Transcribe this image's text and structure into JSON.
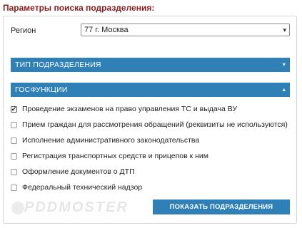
{
  "header": {
    "title": "Параметры поиска подразделения:"
  },
  "region": {
    "label": "Регион",
    "selected": "77 г. Москва",
    "arrow_icon": "▾"
  },
  "sections": {
    "type": {
      "label": "ТИП ПОДРАЗДЕЛЕНИЯ",
      "state": "collapsed",
      "chevron": "▾"
    },
    "gos": {
      "label": "ГОСФУНКЦИИ",
      "state": "expanded",
      "chevron": "▴"
    }
  },
  "services": [
    {
      "label": "Проведение экзаменов на право управления ТС и выдача ВУ",
      "checked": true
    },
    {
      "label": "Прием граждан для рассмотрения обращений (реквизиты не используются)",
      "checked": false
    },
    {
      "label": "Исполнение административного законодательства",
      "checked": false
    },
    {
      "label": "Регистрация транспортных средств и прицепов к ним",
      "checked": false
    },
    {
      "label": "Оформление документов о ДТП",
      "checked": false
    },
    {
      "label": "Федеральный технический надзор",
      "checked": false
    }
  ],
  "watermark": "PDDMOSTER",
  "actions": {
    "show_label": "ПОКАЗАТЬ ПОДРАЗДЕЛЕНИЯ"
  },
  "colors": {
    "accent": "#2e80b6",
    "title": "#8b1a1a"
  }
}
